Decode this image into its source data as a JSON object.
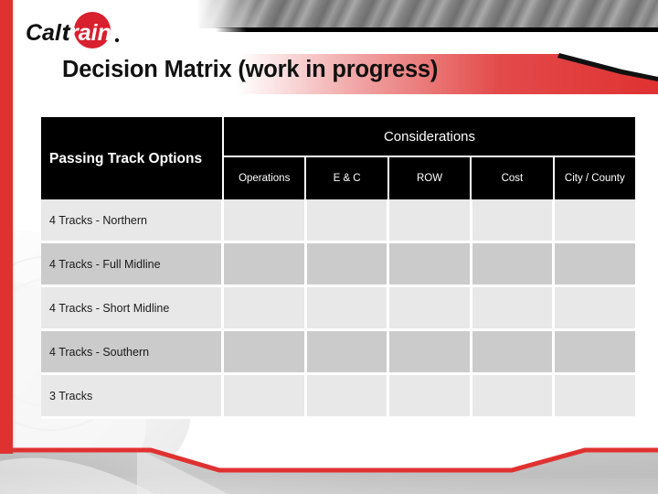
{
  "slide": {
    "brand": {
      "logo_text_left": "Cal",
      "logo_text_right": "train",
      "logo_color_red": "#d8202f",
      "logo_color_black": "#111111"
    },
    "title": "Decision Matrix (work in progress)",
    "accent_red": "#e03131",
    "header_black": "#000000",
    "row_light": "#e8e8e8",
    "row_dark": "#cbcbcb"
  },
  "matrix": {
    "row_header_title": "Passing Track Options",
    "group_header": "Considerations",
    "columns": [
      {
        "label": "Operations"
      },
      {
        "label": "E & C"
      },
      {
        "label": "ROW"
      },
      {
        "label": "Cost"
      },
      {
        "label": "City / County"
      }
    ],
    "rows": [
      {
        "option": "4 Tracks - Northern",
        "cells": [
          "",
          "",
          "",
          "",
          ""
        ]
      },
      {
        "option": "4 Tracks - Full Midline",
        "cells": [
          "",
          "",
          "",
          "",
          ""
        ]
      },
      {
        "option": "4 Tracks - Short Midline",
        "cells": [
          "",
          "",
          "",
          "",
          ""
        ]
      },
      {
        "option": "4 Tracks - Southern",
        "cells": [
          "",
          "",
          "",
          "",
          ""
        ]
      },
      {
        "option": "3 Tracks",
        "cells": [
          "",
          "",
          "",
          "",
          ""
        ]
      }
    ]
  }
}
